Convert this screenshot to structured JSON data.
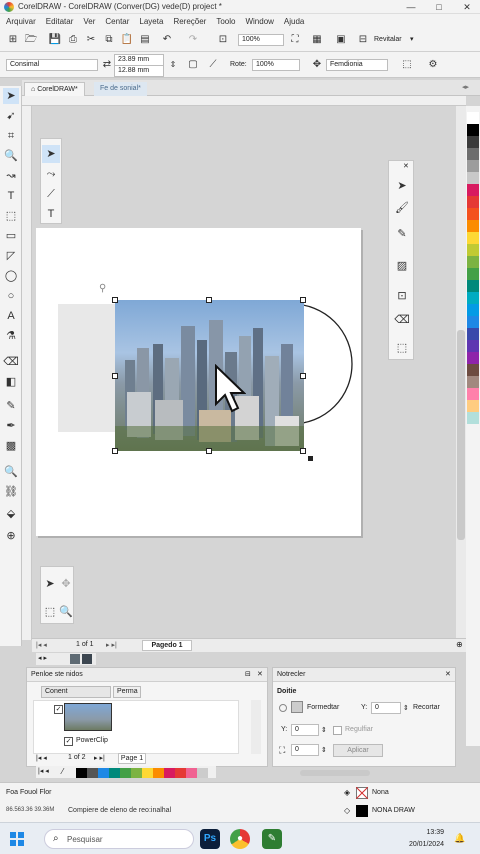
{
  "window": {
    "title": "CorelDRAW - CorelDRAW (Conver(DG) vede(D) project *"
  },
  "menu": [
    "Arquivar",
    "Editatar",
    "Ver",
    "Centar",
    "Layeta",
    "Rereçõer",
    "Toolo",
    "Window",
    "Ajuda"
  ],
  "toolbar": {
    "zoom": "100%",
    "snap_label": "Revitalar"
  },
  "propbar": {
    "font": "Consimal",
    "width": "23.89 mm",
    "height": "12.88 mm",
    "rotate_label": "Rote:",
    "rotate_value": "100%",
    "transform": "Femdionia"
  },
  "tabs": {
    "welcome": "CorelDRAW*",
    "doc": "Fe de sonial*"
  },
  "canvas": {
    "shape_handle_glyph": "⚲"
  },
  "pagenav": {
    "count": "1 of 1",
    "page_tab": "Pagedo 1"
  },
  "objects_docker": {
    "title": "Penloe ste nidos",
    "col_content": "Conent",
    "col_perma": "Perma",
    "item_label": "PowerClip",
    "nav_count": "1 of 2",
    "page_label": "Page 1"
  },
  "notes_docker": {
    "title": "Notrecler",
    "section": "Doitie",
    "formatar": "Formedtar",
    "y_label": "Y:",
    "y_value": "0",
    "recortar": "Recortar",
    "y2_label": "Y:",
    "y2_value": "0",
    "regular": "Regulfiar",
    "x_value": "0",
    "apply": "Aplicar"
  },
  "status": {
    "row1": "Foa Fouol Flor",
    "coords": "86.563.36 39.36M",
    "message": "Compiere de eleno de reo:inalhal",
    "fill_none": "Nona",
    "outline": "NONA DRAW"
  },
  "taskbar": {
    "search": "Pesquisar",
    "time": "13:39",
    "date": "20/01/2024"
  },
  "colors": {
    "accent": "#1e88e5",
    "selection": "#222222"
  },
  "palette_side": [
    "#ffffff",
    "#000000",
    "#3b3b3b",
    "#6d6d6d",
    "#9c9c9c",
    "#c8c8c8",
    "#d81b60",
    "#e53935",
    "#f4511e",
    "#fb8c00",
    "#fdd835",
    "#c0ca33",
    "#7cb342",
    "#43a047",
    "#00897b",
    "#00acc1",
    "#039be5",
    "#1e88e5",
    "#3949ab",
    "#5e35b1",
    "#8e24aa",
    "#6d4c41",
    "#a1887f",
    "#ff80ab",
    "#ffcc80",
    "#b2dfdb"
  ],
  "palette_bottom": [
    "#000000",
    "#555555",
    "#1e88e5",
    "#00897b",
    "#43a047",
    "#7cb342",
    "#fdd835",
    "#fb8c00",
    "#d81b60",
    "#e53935",
    "#f06292",
    "#cccccc"
  ]
}
